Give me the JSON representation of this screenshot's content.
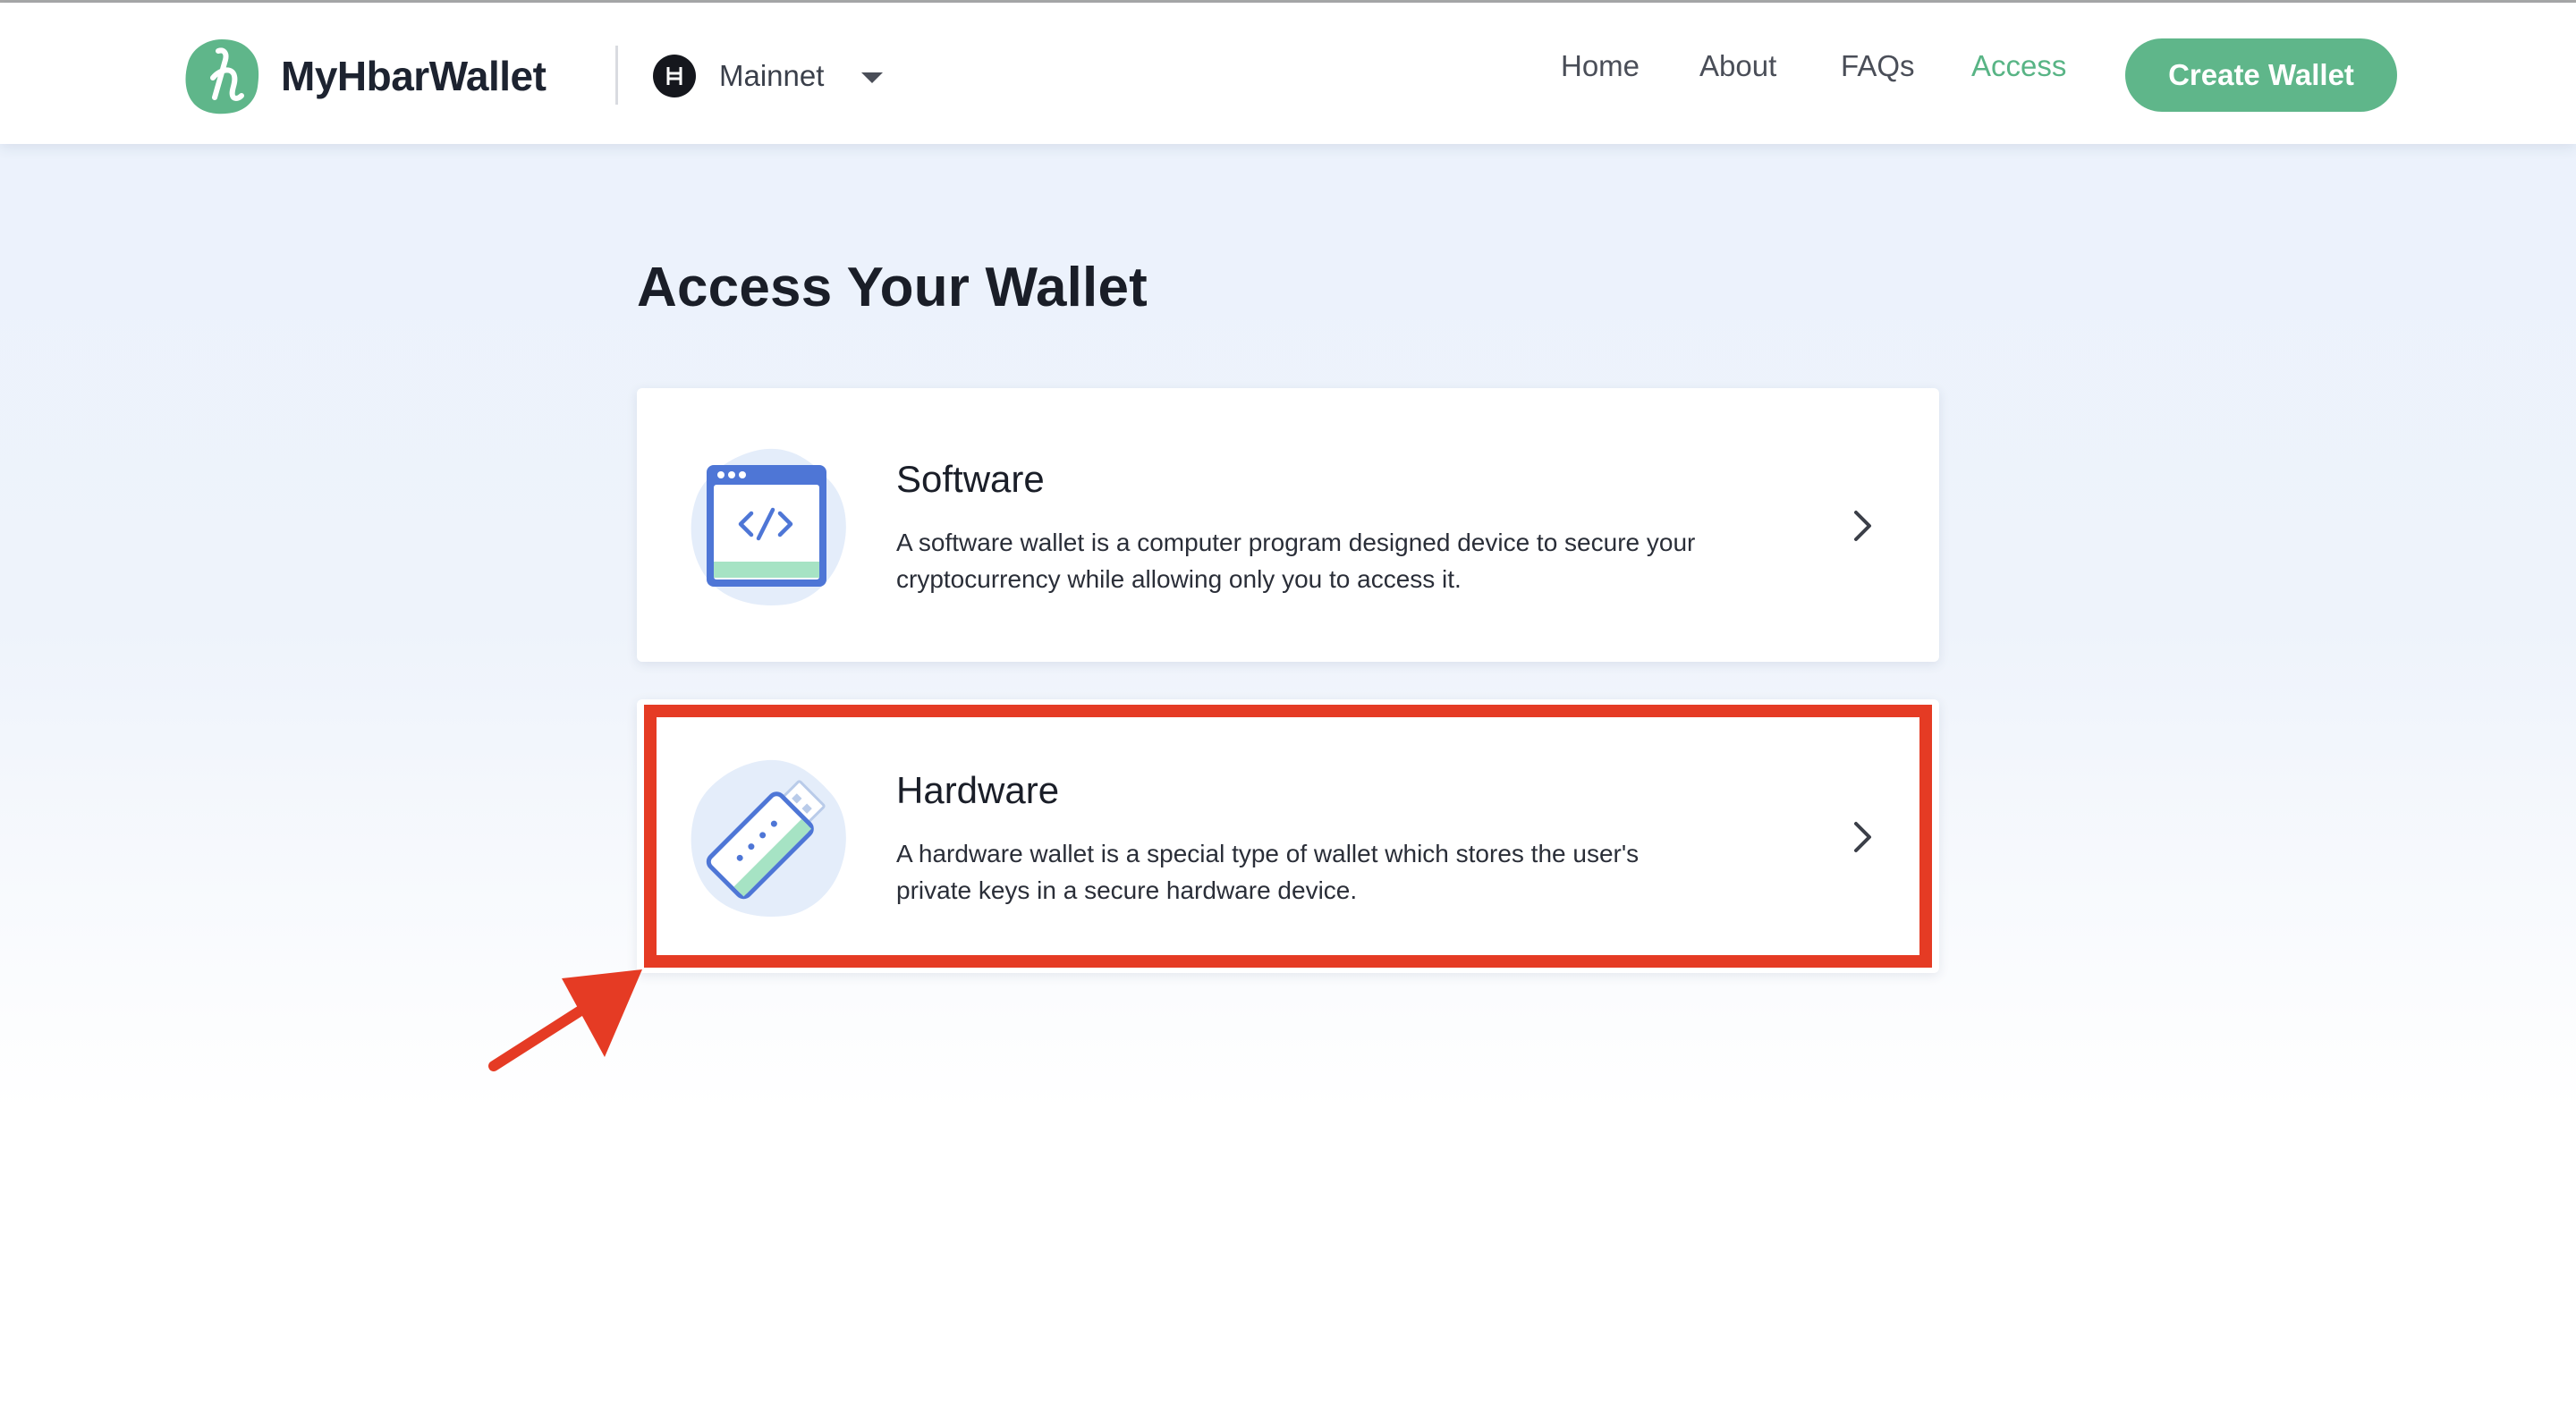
{
  "header": {
    "brand": "MyHbarWallet",
    "network": "Mainnet",
    "nav": [
      {
        "label": "Home",
        "active": false
      },
      {
        "label": "About",
        "active": false
      },
      {
        "label": "FAQs",
        "active": false
      },
      {
        "label": "Access",
        "active": true
      }
    ],
    "create_wallet_label": "Create Wallet"
  },
  "main": {
    "title": "Access Your Wallet",
    "options": [
      {
        "title": "Software",
        "description": "A software wallet is a computer program designed device to secure your cryptocurrency while allowing only you to access it.",
        "icon": "code-window-icon"
      },
      {
        "title": "Hardware",
        "description": "A hardware wallet is a special type of wallet which stores the user's private keys in a secure hardware device.",
        "icon": "usb-stick-icon"
      }
    ]
  },
  "annotation": {
    "highlighted_option": "Hardware",
    "color": "#e53b24"
  },
  "colors": {
    "accent_green": "#5fb68a",
    "access_link": "#58b485",
    "icon_blue": "#4e76d6"
  }
}
